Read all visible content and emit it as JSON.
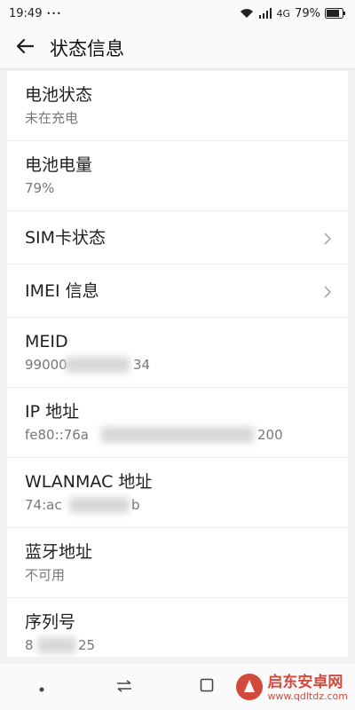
{
  "status_bar": {
    "time": "19:49",
    "more": "•••",
    "network": "4G",
    "battery": "79%"
  },
  "app_bar": {
    "title": "状态信息"
  },
  "rows": [
    {
      "title": "电池状态",
      "value": "未在充电"
    },
    {
      "title": "电池电量",
      "value": "79%"
    },
    {
      "title": "SIM卡状态"
    },
    {
      "title": "IMEI 信息"
    },
    {
      "title": "MEID",
      "value": "99000",
      "value_end": "34"
    },
    {
      "title": "IP 地址",
      "value": "fe80::76a",
      "value_end": "200"
    },
    {
      "title": "WLANMAC 地址",
      "value": "74:ac",
      "value_end": "b"
    },
    {
      "title": "蓝牙地址",
      "value": "不可用"
    },
    {
      "title": "序列号",
      "value": "8",
      "value_end": "25"
    }
  ],
  "watermark": {
    "name": "启东安卓网",
    "url": "www.qdltdz.com",
    "accent": "#d24a3c"
  },
  "icons": [
    "wifi-icon",
    "signal-icon",
    "battery-icon",
    "back-arrow-icon",
    "chevron-right-icon",
    "swap-icon",
    "recents-icon",
    "dot-icon"
  ]
}
